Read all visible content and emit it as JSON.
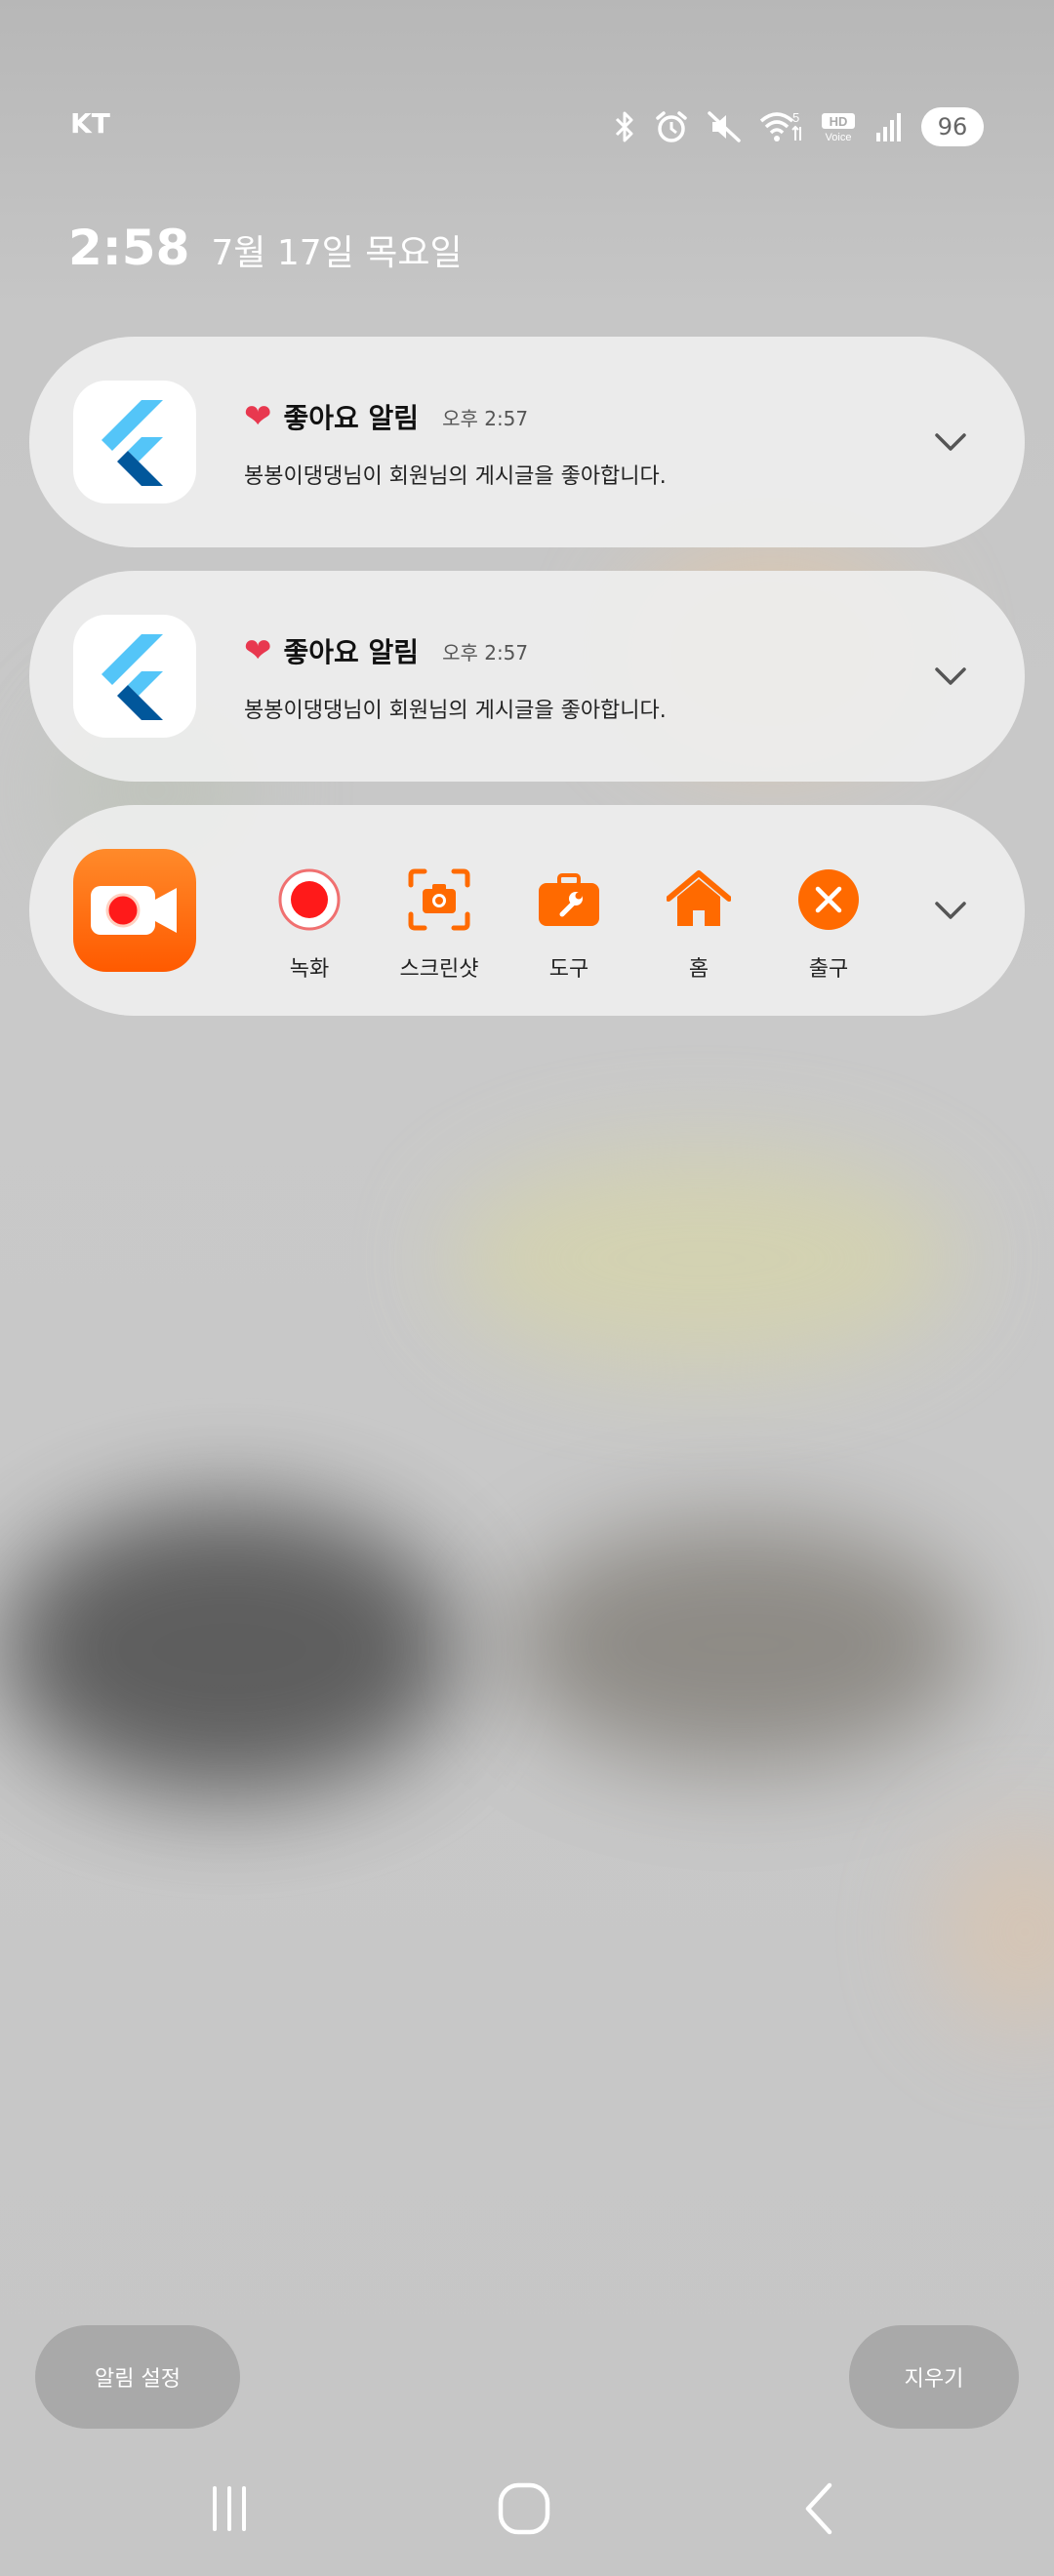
{
  "status_bar": {
    "carrier": "KT",
    "icons": [
      "bluetooth-icon",
      "alarm-icon",
      "mute-icon",
      "wifi-icon",
      "hd-voice-icon",
      "signal-icon"
    ],
    "battery": "96"
  },
  "lockscreen": {
    "time": "2:58",
    "date": "7월 17일 목요일"
  },
  "notifications": [
    {
      "app_icon": "flutter-icon",
      "title": "좋아요 알림",
      "time": "오후 2:57",
      "body": "봉봉이댕댕님이 회원님의 게시글을 좋아합니다."
    },
    {
      "app_icon": "flutter-icon",
      "title": "좋아요 알림",
      "time": "오후 2:57",
      "body": "봉봉이댕댕님이 회원님의 게시글을 좋아합니다."
    }
  ],
  "recorder": {
    "app_icon": "screen-recorder-icon",
    "tools": [
      {
        "label": "녹화",
        "icon": "record-icon"
      },
      {
        "label": "스크린샷",
        "icon": "screenshot-icon"
      },
      {
        "label": "도구",
        "icon": "toolbox-icon"
      },
      {
        "label": "홈",
        "icon": "home-icon"
      },
      {
        "label": "출구",
        "icon": "exit-icon"
      }
    ]
  },
  "actions": {
    "settings": "알림 설정",
    "clear": "지우기"
  },
  "colors": {
    "accent": "#ff6a00",
    "record_red": "#ff1a1a",
    "heart": "#e8384f",
    "flutter_light": "#54c5f8",
    "flutter_dark": "#01579b"
  }
}
